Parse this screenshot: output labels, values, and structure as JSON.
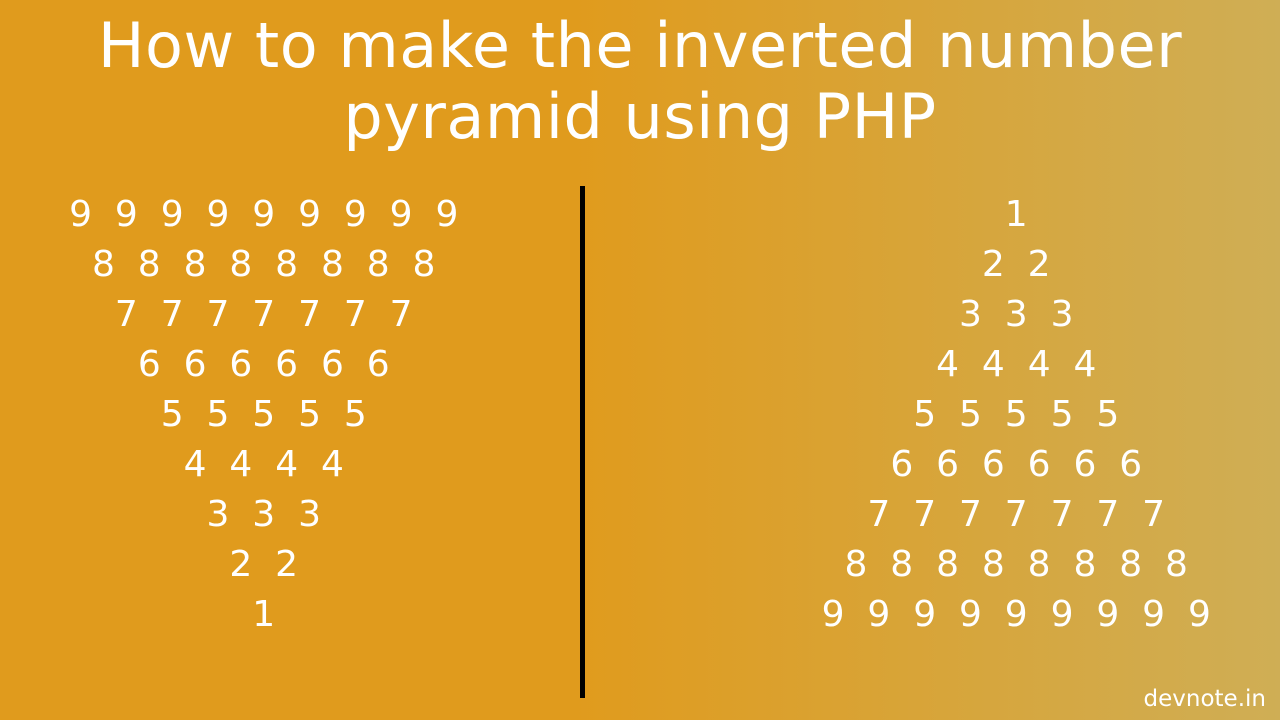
{
  "title_line1": "How to make the inverted number",
  "title_line2": "pyramid using PHP",
  "credit": "devnote.in",
  "left_pyramid": [
    "9  9  9  9  9  9  9  9  9",
    "8  8  8  8  8  8  8  8",
    "7  7  7  7  7  7  7",
    "6  6  6  6  6  6",
    "5  5  5  5  5",
    "4  4  4  4",
    "3  3  3",
    "2  2",
    "1"
  ],
  "right_pyramid": [
    "1",
    "2  2",
    "3  3  3",
    "4  4  4  4",
    "5  5  5  5  5",
    "6  6  6  6  6  6",
    "7  7  7  7  7  7  7",
    "8  8  8  8  8  8  8  8",
    "9  9  9  9  9  9  9  9  9"
  ]
}
